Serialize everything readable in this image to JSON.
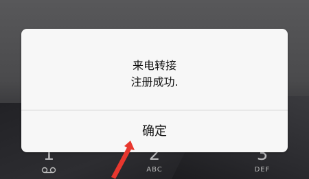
{
  "dialog": {
    "message_line1": "来电转接",
    "message_line2": "注册成功.",
    "confirm_label": "确定"
  },
  "dialpad": {
    "keys": [
      {
        "digit": "1",
        "sub": "",
        "icon": "voicemail-icon"
      },
      {
        "digit": "2",
        "sub": "ABC"
      },
      {
        "digit": "3",
        "sub": "DEF"
      }
    ]
  },
  "annotation": {
    "arrow_color": "#e8372e"
  }
}
